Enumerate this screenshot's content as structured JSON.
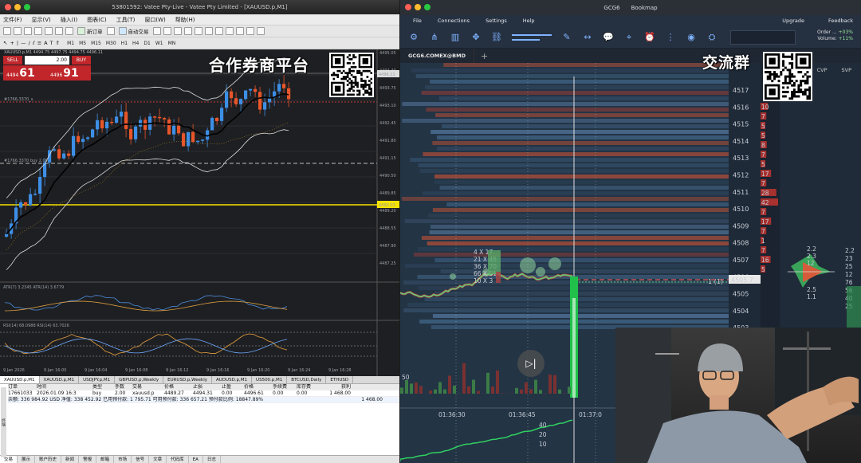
{
  "mt4": {
    "title": "53801592: Vatee Pty-Live - Vatee Pty Limited - [XAUUSD.p,M1]",
    "menu": [
      "文件(F)",
      "显示(V)",
      "插入(I)",
      "图表(C)",
      "工具(T)",
      "窗口(W)",
      "帮助(H)"
    ],
    "toolbar": {
      "new_order": "新订单",
      "auto_trade": "自动交易"
    },
    "timeframes": [
      "M1",
      "M5",
      "M15",
      "M30",
      "H1",
      "H4",
      "D1",
      "W1",
      "MN"
    ],
    "symbol_line": "XAUUSD.p,M1  4494.75  4497.75  4494.75  4496.11",
    "trade_panel": {
      "sell": "SELL",
      "buy": "BUY",
      "lot": "2.00",
      "sell_small": "4494",
      "sell_big": "61",
      "buy_small": "4496",
      "buy_big": "91"
    },
    "overlay_text": "合作券商平台",
    "price_labels": [
      "4495.05",
      "4494.40",
      "4493.75",
      "4493.10",
      "4492.45",
      "4491.80",
      "4491.15",
      "4490.50",
      "4489.85",
      "4489.20",
      "4488.55",
      "4487.90",
      "4487.25"
    ],
    "current_price": "4496.11",
    "hline_price": "4490.03",
    "line_labels": {
      "red": "#1766,3370_s",
      "white": "#1766,3370 buy 2.00"
    },
    "indicators": {
      "atr": "ATR(7) 3.2345 ATR(14) 3.6779",
      "rsi": "RSI(14) 68.0988 RSI(14) 63.7026"
    },
    "time_labels": [
      "9 Jan 2026",
      "9 Jan 16:00",
      "9 Jan 16:04",
      "9 Jan 16:08",
      "9 Jan 16:12",
      "9 Jan 16:16",
      "9 Jan 16:20",
      "9 Jan 16:24",
      "9 Jan 16:28"
    ],
    "symbol_tabs": [
      "XAUUSD.p,M1",
      "XAUUSD.p,M1",
      "USDJPY.p,M1",
      "GBPUSD.p,Weekly",
      "EURUSD.p,Weekly",
      "AUDUSD.p,M1",
      "US500.p,M1",
      "BTCUSD,Daily",
      "ETHUSD"
    ],
    "table": {
      "headers": [
        "订单",
        "时间",
        "类型",
        "手数",
        "交易",
        "价格",
        "止损",
        "止盈",
        "价格",
        "手续费",
        "库存费",
        "获利"
      ],
      "row": [
        "17661033",
        "2026.01.09 16:3",
        "buy",
        "2.00",
        "xauusd.p",
        "4489.27",
        "4494.31",
        "0.00",
        "4496.61",
        "0.00",
        "0.00",
        "1 468.00"
      ],
      "balance": "余额: 336 984.92 USD  净值: 338 452.92  已用预付款: 1 795.71  可用预付款: 336 657.21  预付款比例: 18847.89%",
      "balance_profit": "1 468.00"
    },
    "bottom_tabs": [
      "交易",
      "展示",
      "账户历史",
      "新闻",
      "警报",
      "邮箱",
      "市场",
      "信号",
      "文章",
      "代码库",
      "EA",
      "日志"
    ],
    "side_label": "终端"
  },
  "bookmap": {
    "title": "GCG6",
    "title2": "Bookmap",
    "menu": [
      "File",
      "Connections",
      "Settings",
      "Help"
    ],
    "menu_right": [
      "Upgrade",
      "Feedback"
    ],
    "tab": "GCG6.COMEX@BMD",
    "order_label": "Order ...",
    "order_val": "+03%",
    "volume_label": "Volume:",
    "volume_val": "+11%",
    "cvp": [
      "CVP",
      "SVP"
    ],
    "overlay_text": "交流群",
    "prices": [
      "4517",
      "4516",
      "4515",
      "4514",
      "4513",
      "4512",
      "4511",
      "4510",
      "4509",
      "4508",
      "4507",
      "4506",
      "4505",
      "4504",
      "4503"
    ],
    "current_price": "4505.7",
    "level_tag": "1 (1)",
    "bubbles": [
      "4 X 17",
      "21 X 45",
      "36 X 70",
      "66 X 51",
      "10 X 3"
    ],
    "time_labels": [
      "01:36:30",
      "01:36:45",
      "01:37:0"
    ],
    "vol_scale": [
      "50",
      "40",
      "20",
      "10"
    ],
    "svp_numbers": [
      "10",
      "7",
      "5",
      "5",
      "8",
      "7",
      "5",
      "17",
      "7",
      "28",
      "42",
      "7",
      "17",
      "7",
      "1",
      "7",
      "16",
      "5"
    ],
    "side_numbers_a": [
      "2.2",
      "2.3",
      "12",
      "2.5",
      "1.1"
    ],
    "side_numbers_b": [
      "2.2",
      "23",
      "25",
      "12",
      "76",
      "56",
      "40",
      "25"
    ]
  },
  "colors": {
    "bull": "#3d8fe6",
    "bear": "#e8562a",
    "hline": "#f5e400",
    "bm_bg": "#233445",
    "price_green": "#5fd07a"
  }
}
